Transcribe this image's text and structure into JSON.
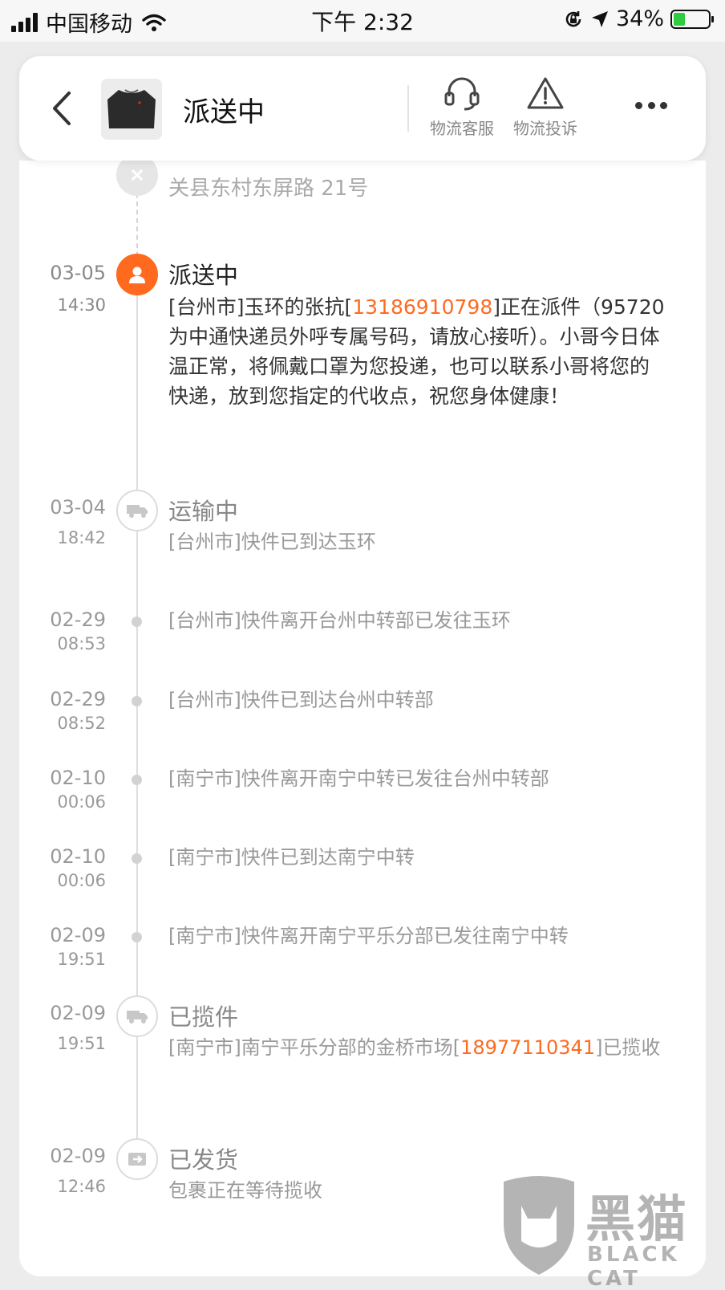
{
  "status_bar": {
    "carrier": "中国移动",
    "time": "下午 2:32",
    "battery_percent": "34%",
    "battery_level": 0.34,
    "colors": {
      "battery": "#2ecc40"
    }
  },
  "header": {
    "title": "派送中",
    "product_thumbnail_icon": "sweater-thumbnail",
    "actions": [
      {
        "label": "物流客服",
        "icon": "headset-icon"
      },
      {
        "label": "物流投诉",
        "icon": "warning-triangle-icon"
      }
    ],
    "more_icon": "more-dots-icon"
  },
  "timeline": {
    "top_partial_text": "关县东村东屏路 21号",
    "accent_color": "#ff6a1f",
    "events": [
      {
        "date": "03-05",
        "time": "14:30",
        "title": "派送中",
        "status": "active",
        "icon": "person-icon",
        "text_pre": "[台州市]玉环的张抗[",
        "phone": "13186910798",
        "text_post": "]正在派件（95720为中通快递员外呼专属号码，请放心接听）。小哥今日体温正常，将佩戴口罩为您投递，也可以联系小哥将您的快递，放到您指定的代收点，祝您身体健康！"
      },
      {
        "date": "03-04",
        "time": "18:42",
        "title": "运输中",
        "status": "major",
        "icon": "truck-icon",
        "text": "[台州市]快件已到达玉环"
      },
      {
        "date": "02-29",
        "time": "08:53",
        "status": "minor",
        "text": "[台州市]快件离开台州中转部已发往玉环"
      },
      {
        "date": "02-29",
        "time": "08:52",
        "status": "minor",
        "text": "[台州市]快件已到达台州中转部"
      },
      {
        "date": "02-10",
        "time": "00:06",
        "status": "minor",
        "text": "[南宁市]快件离开南宁中转已发往台州中转部"
      },
      {
        "date": "02-10",
        "time": "00:06",
        "status": "minor",
        "text": "[南宁市]快件已到达南宁中转"
      },
      {
        "date": "02-09",
        "time": "19:51",
        "status": "minor",
        "text": "[南宁市]快件离开南宁平乐分部已发往南宁中转"
      },
      {
        "date": "02-09",
        "time": "19:51",
        "title": "已揽件",
        "status": "major",
        "icon": "pickup-truck-icon",
        "text_pre": "[南宁市]南宁平乐分部的金桥市场[",
        "phone": "18977110341",
        "text_post": "]已揽收"
      },
      {
        "date": "02-09",
        "time": "12:46",
        "title": "已发货",
        "status": "major",
        "icon": "shipped-box-icon",
        "text": "包裹正在等待揽收"
      }
    ]
  },
  "watermark": {
    "cn": "黑猫",
    "en": "BLACK CAT"
  }
}
